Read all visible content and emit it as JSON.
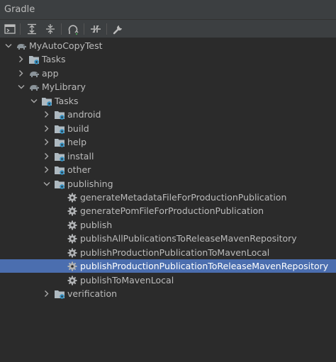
{
  "window": {
    "title": "Gradle"
  },
  "toolbar": {
    "buttons": [
      {
        "icon": "terminal-icon"
      },
      {
        "icon": "expand-all-icon"
      },
      {
        "icon": "collapse-all-icon"
      },
      {
        "icon": "reload-icon"
      },
      {
        "icon": "toggle-offline-icon"
      },
      {
        "icon": "wrench-icon"
      }
    ]
  },
  "tree": {
    "items": [
      {
        "label": "MyAutoCopyTest",
        "kind": "project",
        "expanded": true
      },
      {
        "label": "Tasks",
        "kind": "folder",
        "expanded": false
      },
      {
        "label": "app",
        "kind": "module",
        "expanded": false
      },
      {
        "label": "MyLibrary",
        "kind": "module",
        "expanded": true
      },
      {
        "label": "Tasks",
        "kind": "folder",
        "expanded": true
      },
      {
        "label": "android",
        "kind": "folder",
        "expanded": false
      },
      {
        "label": "build",
        "kind": "folder",
        "expanded": false
      },
      {
        "label": "help",
        "kind": "folder",
        "expanded": false
      },
      {
        "label": "install",
        "kind": "folder",
        "expanded": false
      },
      {
        "label": "other",
        "kind": "folder",
        "expanded": false
      },
      {
        "label": "publishing",
        "kind": "folder",
        "expanded": true
      },
      {
        "label": "generateMetadataFileForProductionPublication",
        "kind": "task"
      },
      {
        "label": "generatePomFileForProductionPublication",
        "kind": "task"
      },
      {
        "label": "publish",
        "kind": "task"
      },
      {
        "label": "publishAllPublicationsToReleaseMavenRepository",
        "kind": "task"
      },
      {
        "label": "publishProductionPublicationToMavenLocal",
        "kind": "task"
      },
      {
        "label": "publishProductionPublicationToReleaseMavenRepository",
        "kind": "task",
        "selected": true
      },
      {
        "label": "publishToMavenLocal",
        "kind": "task"
      },
      {
        "label": "verification",
        "kind": "folder",
        "expanded": false
      }
    ]
  },
  "colors": {
    "selection": "#4b6eaf",
    "background": "#2b2b2b",
    "toolbar": "#3c3f41"
  }
}
